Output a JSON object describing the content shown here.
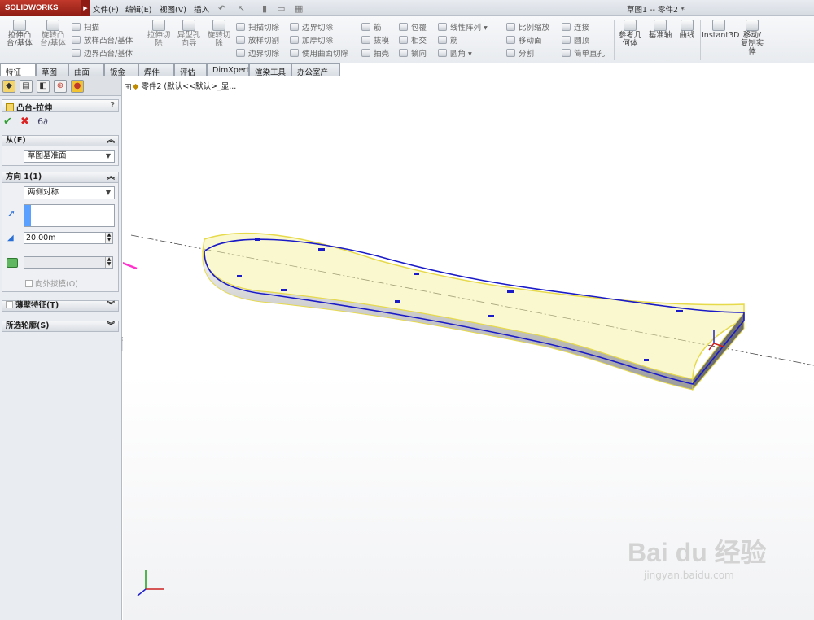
{
  "app": {
    "brand": "SOLIDWORKS",
    "doc_title": "草图1 -- 零件2 *"
  },
  "menus": [
    "文件(F)",
    "编辑(E)",
    "视图(V)",
    "插入"
  ],
  "commands": {
    "big": [
      {
        "label": "拉伸凸\n台/基体"
      },
      {
        "label": "旋转凸\n台/基体"
      },
      {
        "label": "拉伸切\n除"
      },
      {
        "label": "异型孔\n向导"
      },
      {
        "label": "旋转切\n除"
      },
      {
        "label": "参考几\n何体"
      },
      {
        "label": "基准轴"
      },
      {
        "label": "曲线"
      },
      {
        "label": "Instant3D"
      },
      {
        "label": "移动/\n复制实\n体"
      }
    ],
    "small": [
      {
        "label": "扫描"
      },
      {
        "label": "放样凸台/基体"
      },
      {
        "label": "边界凸台/基体"
      },
      {
        "label": "扫描切除"
      },
      {
        "label": "放样切割"
      },
      {
        "label": "边界切除"
      },
      {
        "label": "边界切除"
      },
      {
        "label": "加厚切除"
      },
      {
        "label": "使用曲面切除"
      },
      {
        "label": "筋"
      },
      {
        "label": "拔模"
      },
      {
        "label": "抽壳"
      },
      {
        "label": "包覆"
      },
      {
        "label": "相交"
      },
      {
        "label": "镜向"
      },
      {
        "label": "线性阵列"
      },
      {
        "label": "筋"
      },
      {
        "label": "圆角"
      },
      {
        "label": "比例缩放"
      },
      {
        "label": "移动面"
      },
      {
        "label": "分割"
      },
      {
        "label": "连接"
      },
      {
        "label": "圆顶"
      },
      {
        "label": "简单直孔"
      }
    ]
  },
  "tabs": [
    "特征",
    "草图",
    "曲面",
    "钣金",
    "焊件",
    "评估",
    "DimXpert",
    "渲染工具",
    "办公室产品"
  ],
  "property_manager": {
    "title": "凸台-拉伸",
    "help": "?",
    "from": {
      "header": "从(F)",
      "value": "草图基准面"
    },
    "direction1": {
      "header": "方向 1(1)",
      "end_condition": "两侧对称",
      "depth": "20.00m",
      "draft_label": "向外拔模(O)"
    },
    "thin_feature": "薄壁特征(T)",
    "selected_contours": "所选轮廓(S)"
  },
  "tree": {
    "root": "零件2 (默认<<默认>_显..."
  },
  "watermark": {
    "brand": "Bai du 经验",
    "url": "jingyan.baidu.com"
  }
}
